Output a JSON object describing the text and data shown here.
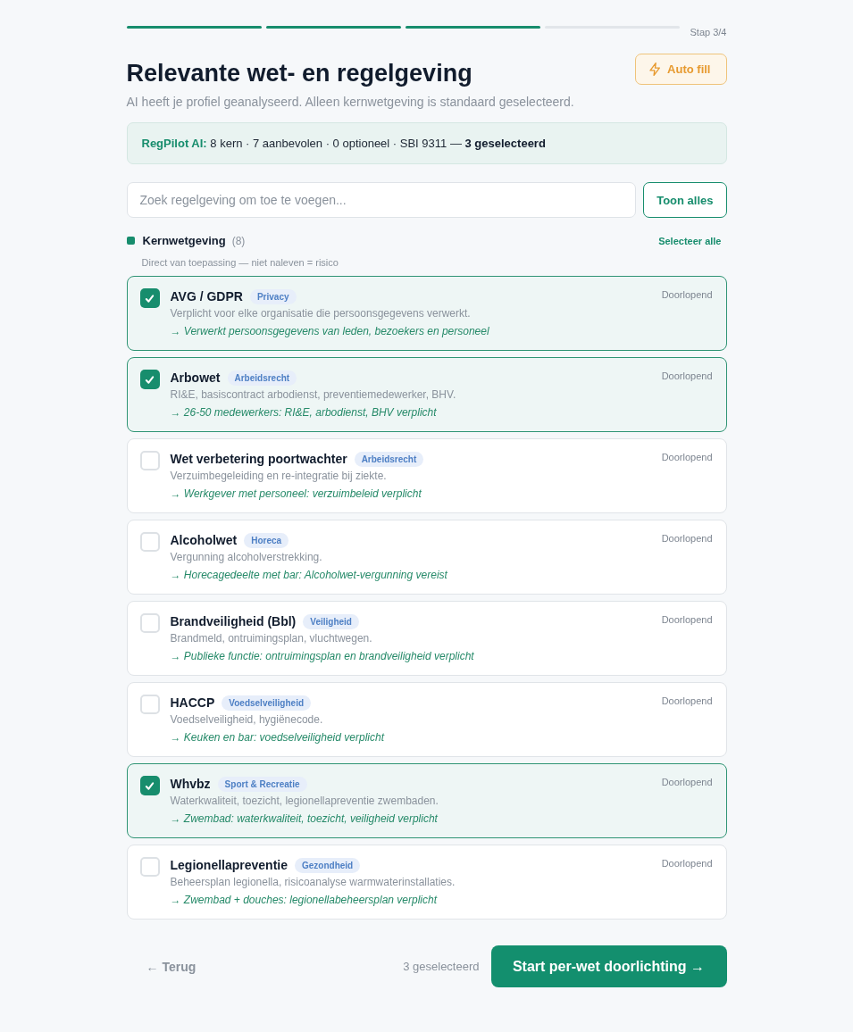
{
  "progress": {
    "steps": [
      {
        "done": true
      },
      {
        "done": true
      },
      {
        "done": true
      },
      {
        "done": false
      }
    ],
    "label": "Stap 3/4"
  },
  "header": {
    "title": "Relevante wet- en regelgeving",
    "subtitle": "AI heeft je profiel geanalyseerd. Alleen kernwetgeving is standaard geselecteerd.",
    "auto_fill_button": "Auto fill"
  },
  "summary": {
    "brand": "RegPilot AI:",
    "text": "8 kern · 7 aanbevolen · 0 optioneel · SBI 9311 — **3 geselecteerd**"
  },
  "search": {
    "placeholder": "Zoek regelgeving om toe te voegen...",
    "show_all_button": "Toon alles"
  },
  "section": {
    "title": "Kernwetgeving",
    "count": "(8)",
    "select_all": "Selecteer alle",
    "description": "Direct van toepassing — niet naleven = risico",
    "items": [
      {
        "name": "AVG / GDPR",
        "tag": "Privacy",
        "description": "Verplicht voor elke organisatie die persoonsgegevens verwerkt.",
        "reason": "→ Verwerkt persoonsgegevens van leden, bezoekers en personeel",
        "status": "Doorlopend",
        "checked": true
      },
      {
        "name": "Arbowet",
        "tag": "Arbeidsrecht",
        "description": "RI&E, basiscontract arbodienst, preventiemedewerker, BHV.",
        "reason": "→ 26-50 medewerkers: RI&E, arbodienst, BHV verplicht",
        "status": "Doorlopend",
        "checked": true
      },
      {
        "name": "Wet verbetering poortwachter",
        "tag": "Arbeidsrecht",
        "description": "Verzuimbegeleiding en re-integratie bij ziekte.",
        "reason": "→ Werkgever met personeel: verzuimbeleid verplicht",
        "status": "Doorlopend",
        "checked": false
      },
      {
        "name": "Alcoholwet",
        "tag": "Horeca",
        "description": "Vergunning alcoholverstrekking.",
        "reason": "→ Horecagedeelte met bar: Alcoholwet-vergunning vereist",
        "status": "Doorlopend",
        "checked": false
      },
      {
        "name": "Brandveiligheid (Bbl)",
        "tag": "Veiligheid",
        "description": "Brandmeld, ontruimingsplan, vluchtwegen.",
        "reason": "→ Publieke functie: ontruimingsplan en brandveiligheid verplicht",
        "status": "Doorlopend",
        "checked": false
      },
      {
        "name": "HACCP",
        "tag": "Voedselveiligheid",
        "description": "Voedselveiligheid, hygiënecode.",
        "reason": "→ Keuken en bar: voedselveiligheid verplicht",
        "status": "Doorlopend",
        "checked": false
      },
      {
        "name": "Whvbz",
        "tag": "Sport & Recreatie",
        "description": "Waterkwaliteit, toezicht, legionellapreventie zwembaden.",
        "reason": "→ Zwembad: waterkwaliteit, toezicht, veiligheid verplicht",
        "status": "Doorlopend",
        "checked": true
      },
      {
        "name": "Legionellapreventie",
        "tag": "Gezondheid",
        "description": "Beheersplan legionella, risicoanalyse warmwaterinstallaties.",
        "reason": "→ Zwembad + douches: legionellabeheersplan verplicht",
        "status": "Doorlopend",
        "checked": false
      }
    ]
  },
  "footer": {
    "back_button": "← Terug",
    "selected_count": "3 geselecteerd",
    "start_button": "Start per-wet doorlichting →"
  }
}
